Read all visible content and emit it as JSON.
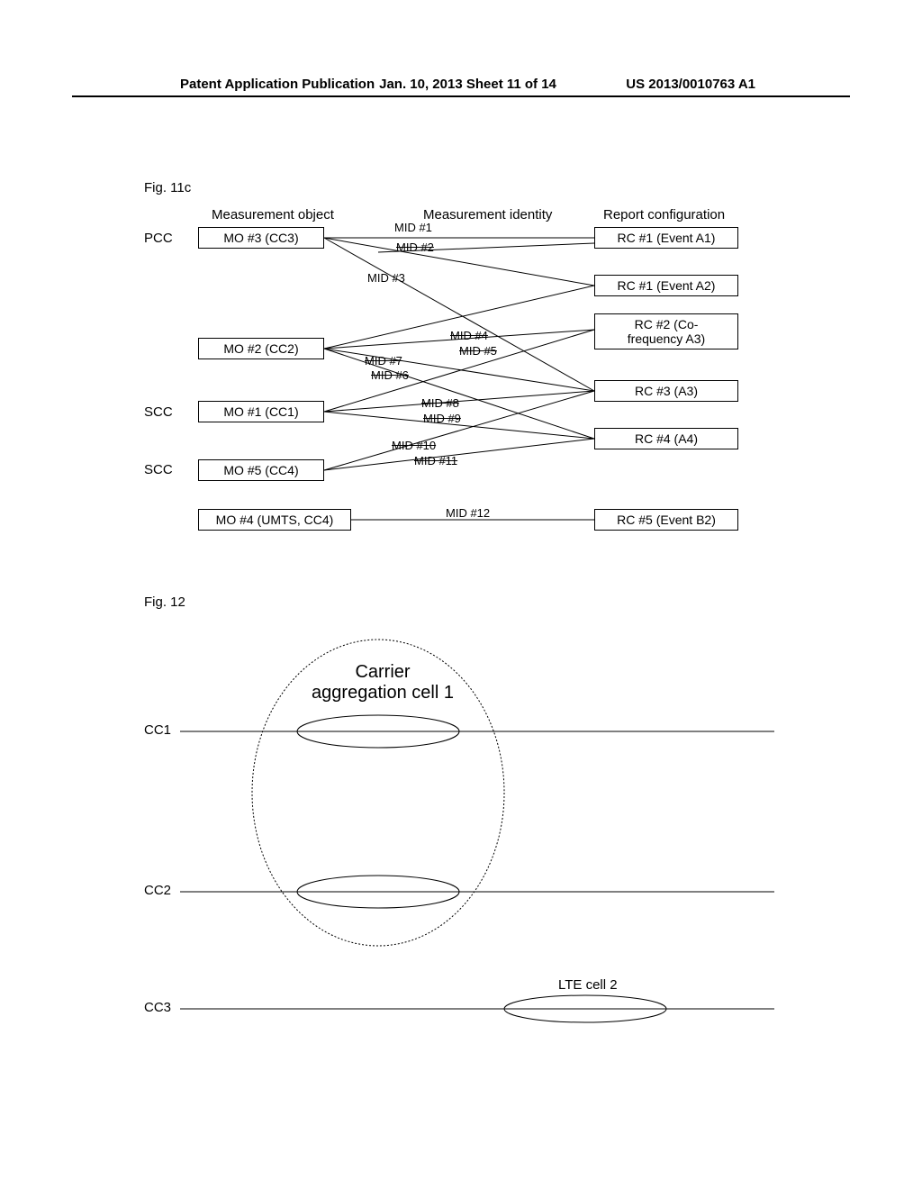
{
  "header": {
    "left": "Patent Application Publication",
    "mid": "Jan. 10, 2013  Sheet 11 of 14",
    "right": "US 2013/0010763 A1"
  },
  "fig11c_label": "Fig. 11c",
  "fig12_label": "Fig. 12",
  "cols": {
    "mo": "Measurement object",
    "mid": "Measurement identity",
    "rc": "Report configuration"
  },
  "side": {
    "pcc": "PCC",
    "scc1": "SCC",
    "scc2": "SCC"
  },
  "mo": {
    "mo3": "MO #3 (CC3)",
    "mo2": "MO #2 (CC2)",
    "mo1": "MO #1 (CC1)",
    "mo5": "MO #5 (CC4)",
    "mo4": "MO #4 (UMTS, CC4)"
  },
  "rc": {
    "rc1a1": "RC #1 (Event A1)",
    "rc1a2": "RC #1 (Event A2)",
    "rc2": "RC #2 (Co-\nfrequency A3)",
    "rc2_l1": "RC #2 (Co-",
    "rc2_l2": "frequency A3)",
    "rc3": "RC #3 (A3)",
    "rc4": "RC #4 (A4)",
    "rc5": "RC #5 (Event B2)"
  },
  "mids": {
    "m1": "MID #1",
    "m2": "MID #2",
    "m3": "MID #3",
    "m4": "MID #4",
    "m5": "MID #5",
    "m6": "MID #6",
    "m7": "MID #7",
    "m8": "MID #8",
    "m9": "MID #9",
    "m10": "MID #10",
    "m11": "MID #11",
    "m12": "MID #12"
  },
  "fig12": {
    "title_l1": "Carrier",
    "title_l2": "aggregation cell 1",
    "cc1": "CC1",
    "cc2": "CC2",
    "cc3": "CC3",
    "lte": "LTE cell 2"
  }
}
